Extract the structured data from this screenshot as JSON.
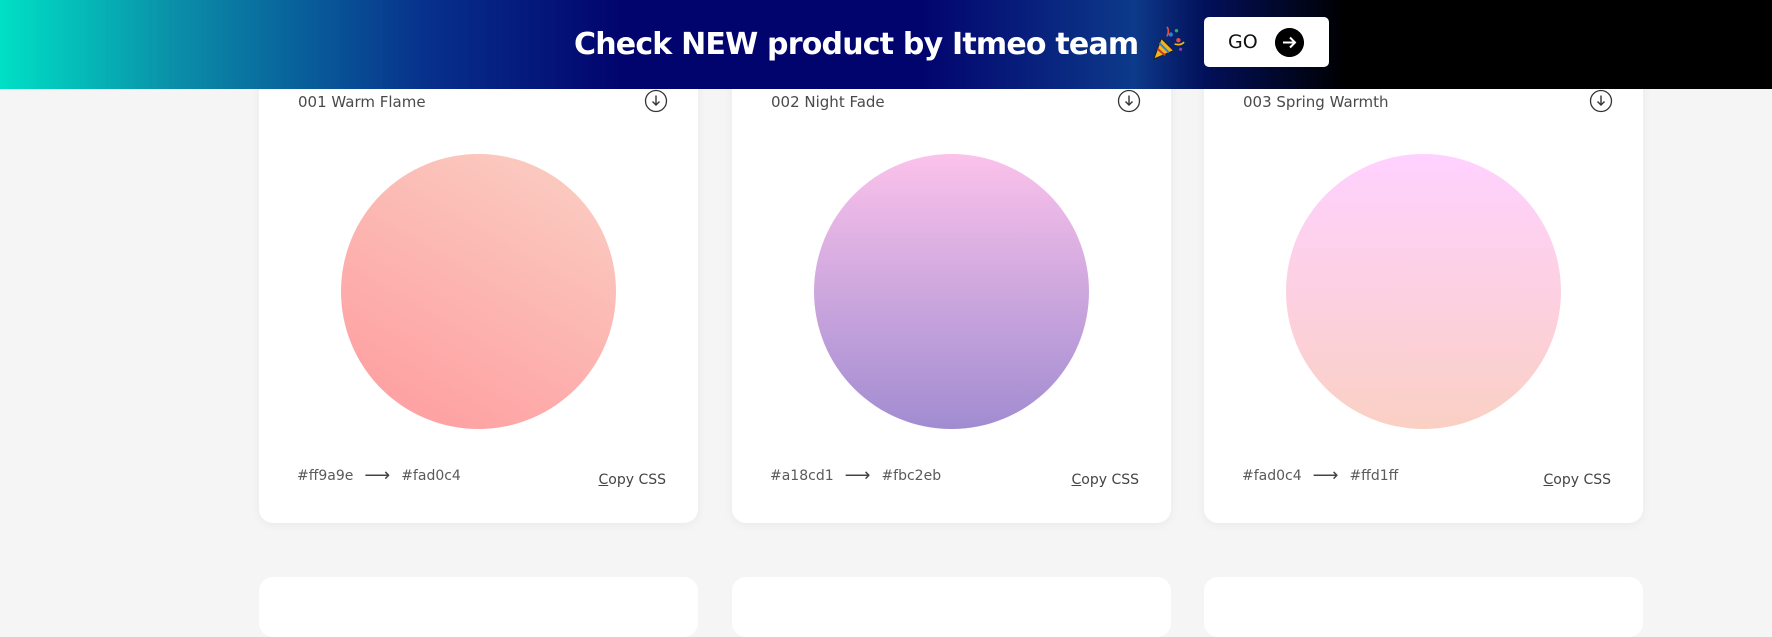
{
  "banner": {
    "text": "Check NEW product by Itmeo team",
    "icon": "party-popper-icon",
    "go_label": "GO",
    "go_icon": "arrow-right-icon"
  },
  "cards": [
    {
      "title": "001 Warm Flame",
      "from": "#ff9a9e",
      "to": "#fad0c4",
      "copy_label": "Copy CSS"
    },
    {
      "title": "002 Night Fade",
      "from": "#a18cd1",
      "to": "#fbc2eb",
      "copy_label": "Copy CSS"
    },
    {
      "title": "003 Spring Warmth",
      "from": "#fad0c4",
      "to": "#ffd1ff",
      "copy_label": "Copy CSS"
    }
  ],
  "arrow_glyph": "⟶"
}
